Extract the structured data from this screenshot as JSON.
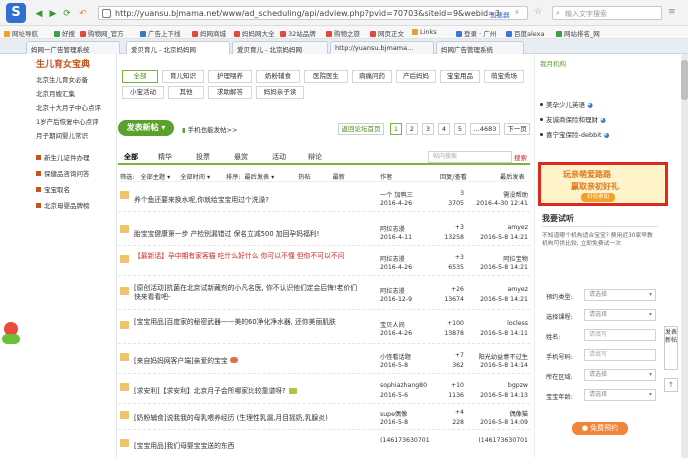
{
  "browser": {
    "url": "http://yuansu.bjmama.net/www/ad_scheduling/api/adview.php?pvid=70703&siteid=9&webid=3",
    "url_suffix": "加速器",
    "search_placeholder": "输入文字搜索",
    "favorites": [
      "网址导航",
      "好搜",
      "购物网_官方",
      "广告上下线",
      "妈网商城",
      "妈妈网大全",
      "32站品牌",
      "购物之旅",
      "网页正文",
      "Links",
      "登录 · 广州",
      "百度alexa",
      "网站排名_网"
    ],
    "tabs": [
      "妈网一广告管理系统",
      "爱贝育儿 - 北京妈妈网",
      "爱贝育儿 - 北京妈妈网",
      "http://yuansu.bjmama...",
      "妈网广告管理系统"
    ]
  },
  "left_nav": {
    "title": "生儿育女宝典",
    "items": [
      "北京生儿育女必备",
      "北京月嫂汇集",
      "北京十大月子中心点评",
      "1岁产后恢复中心点评",
      "月子期间婴儿常识"
    ],
    "links": [
      "新生儿证件办理",
      "保健品咨询问答",
      "宝宝取名",
      "北京母婴品牌榜"
    ]
  },
  "categories": [
    "全部",
    "育儿知识",
    "护理喂养",
    "奶粉辅食",
    "医院医生",
    "病痛问药",
    "产后妈妈",
    "宝宝用品",
    "萌宝秀场",
    "小宝活动",
    "其他",
    "求助解答",
    "妈妈亲子读"
  ],
  "toolbar": {
    "post_button": "发表新帖",
    "post_link": "手机也能发帖>>",
    "back_list": "返回论坛首页",
    "pages": [
      "1",
      "2",
      "3",
      "4",
      "5",
      "...4683",
      "下一页"
    ]
  },
  "main_tabs": [
    "全部",
    "精华",
    "投票",
    "悬赏",
    "活动",
    "辩论"
  ],
  "search_box": {
    "placeholder": "帖内搜索",
    "button": "搜索"
  },
  "filter": {
    "label": "筛选:",
    "type": "全部主题",
    "time": "全部时间",
    "sort_label": "排序:",
    "sort": "最后发表",
    "cols": [
      "热帖",
      "最新"
    ]
  },
  "table_header": {
    "author": "作者",
    "reply": "回复/查看",
    "last": "最后发表"
  },
  "threads": [
    {
      "title": "养个鱼还要来换水呢,你就给宝宝用过个洗澡?",
      "author": "一个 加鸭三",
      "date": "2016-4-26",
      "reply": "3",
      "view": "3705",
      "last": "需没帮助",
      "last_time": "2016-4-30 12:41",
      "red": false
    },
    {
      "title": "胎宝宝健康第一步 产检别漏错过 保名立减500 加回孕妈福利!",
      "author": "阿拉志漫",
      "date": "2016-4-11",
      "reply": "+3",
      "view": "13258",
      "last": "amyez",
      "last_time": "2016-5-8 14:21",
      "red": false
    },
    {
      "title": "【最新话】孕中期有家客猫 吃什么好什么 你可以不懂 但你不可以不问",
      "author": "阿拉志漫",
      "date": "2016-4-26",
      "reply": "+3",
      "view": "6535",
      "last": "阿拉宝物",
      "last_time": "2016-5-8 14:21",
      "red": true
    },
    {
      "title": "[原创活动]抗菌在北京试新藏剂的小凡名医, 你不认识他们定会后悔!老价们快来看看吧-",
      "author": "阿拉志漫",
      "date": "2016-12-9",
      "reply": "+26",
      "view": "13674",
      "last": "amyez",
      "last_time": "2016-5-8 14:21",
      "red": false
    },
    {
      "title": "[宝宝用品]百度家的秘密武器——美的60净化净水器, 还你美丽肌肤",
      "author": "宝贝人间",
      "date": "2016-4-26",
      "reply": "+100",
      "view": "13878",
      "last": "locless",
      "last_time": "2016-5-8 14:11",
      "red": false
    },
    {
      "title": "[来自妈妈网客户端]亲爱的宝宝",
      "author": "小怪看话题",
      "date": "2016-5-8",
      "reply": "+7",
      "view": "362",
      "last": "阳光幼益意不过生",
      "last_time": "2016-5-8 14:14",
      "red": false
    },
    {
      "title": "[求安利]【求安利】北京月子会所哪家比较靠谱呀?",
      "author": "sophiazhang80",
      "date": "2016-5-6",
      "reply": "+10",
      "view": "1136",
      "last": "bgpzw",
      "last_time": "2016-5-8 14:13",
      "red": false
    },
    {
      "title": "[奶粉辅食]说我我的母乳喂养经历 (生理性乳漏,月目摇奶,乳腺炎)",
      "author": "supe偶像",
      "date": "2016-5-8",
      "reply": "+4",
      "view": "228",
      "last": "偶像猫",
      "last_time": "2016-5-8 14:09",
      "red": false
    },
    {
      "title": "[宝宝用品]我们母婴宝宝送的东西",
      "author": "(146173630701",
      "date": "2016-5-3",
      "reply": "",
      "view": "",
      "last": "(146173630701",
      "last_time": "",
      "red": false
    }
  ],
  "right_col": {
    "top_label": "我月机构",
    "list": [
      "美孕少儿英语",
      "友诚商保险和理财",
      "喜宁宝保险-debbit"
    ],
    "ad": {
      "line1": "玩亲萌爱路路",
      "line2": "赢取亲初好礼",
      "button": "扫码参加"
    },
    "form_title": "我要试听",
    "form_desc": "不知道哪个机构适合宝宝? 费用近30家早教机构可供比较, 立即免费试一次",
    "fields": [
      {
        "label": "预约类型:",
        "placeholder": "请选择",
        "type": "select"
      },
      {
        "label": "选择课程:",
        "placeholder": "请选择",
        "type": "select"
      },
      {
        "label": "姓名:",
        "placeholder": "请填写",
        "type": "input"
      },
      {
        "label": "手机号码:",
        "placeholder": "请填写",
        "type": "input"
      },
      {
        "label": "所在区域:",
        "placeholder": "请选择",
        "type": "select"
      },
      {
        "label": "宝宝年龄:",
        "placeholder": "请选择",
        "type": "select"
      }
    ],
    "apply": "免费预约"
  },
  "side_float": "发表新帖",
  "top_btn": "↑",
  "colors": {
    "accent_green": "#5aa02c",
    "brand_orange": "#c2541f",
    "highlight_red": "#e0281e"
  }
}
